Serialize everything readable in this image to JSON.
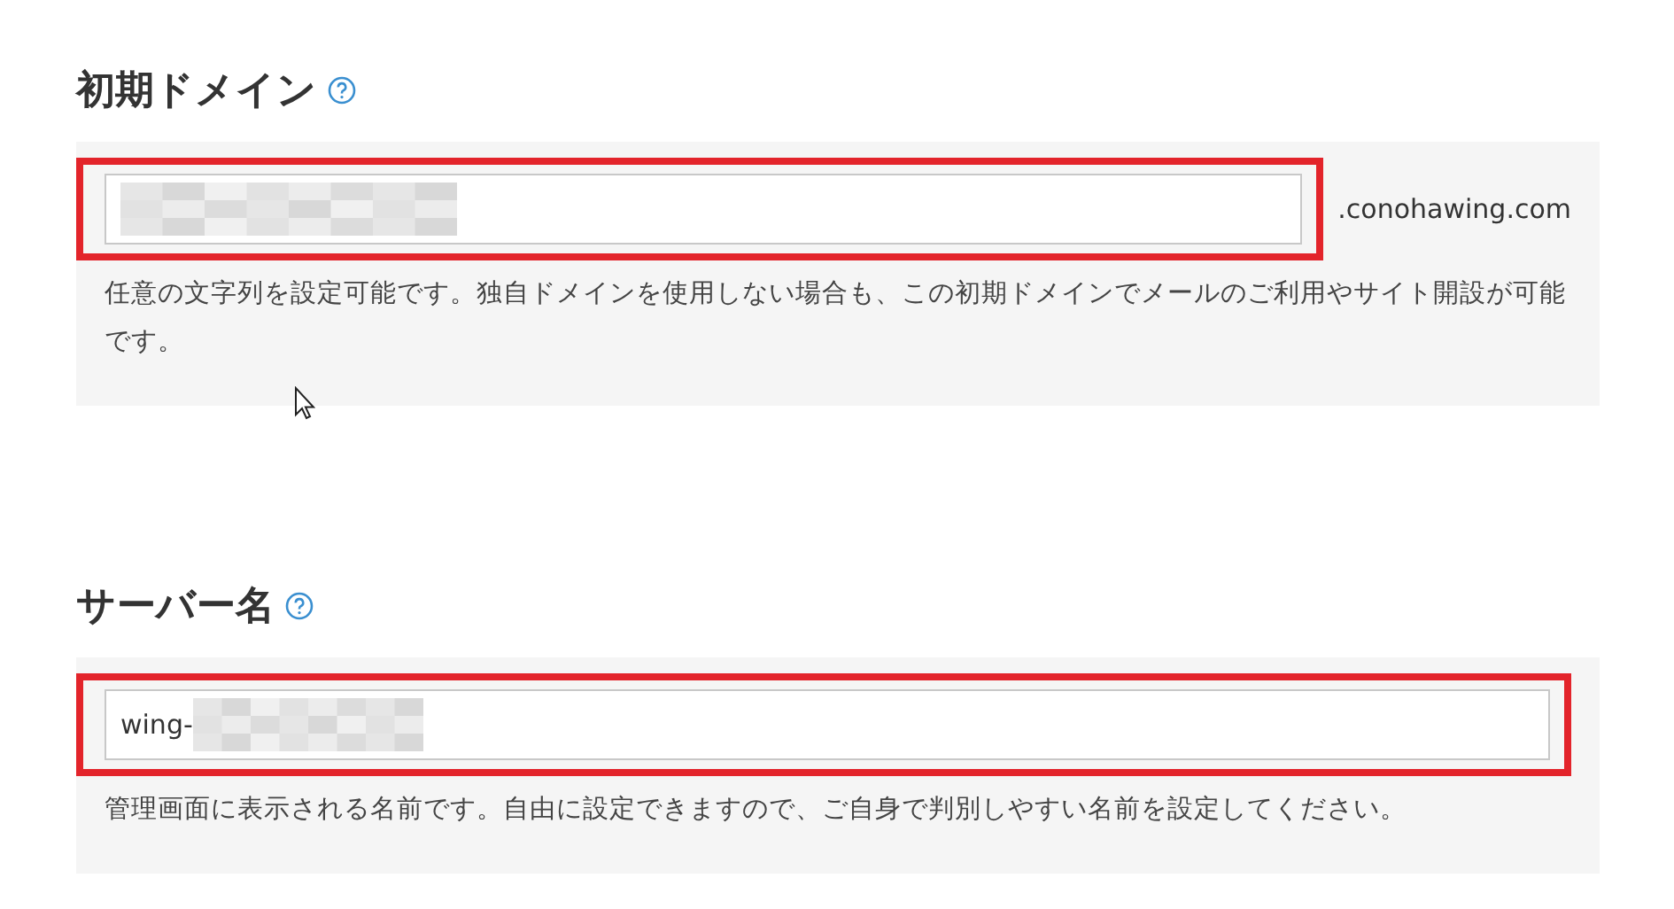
{
  "sections": [
    {
      "title": "初期ドメイン",
      "field": {
        "redacted": true,
        "suffix": ".conohawing.com",
        "highlighted": true
      },
      "help": "任意の文字列を設定可能です。独自ドメインを使用しない場合も、この初期ドメインでメールのご利用やサイト開設が可能です。"
    },
    {
      "title": "サーバー名",
      "field": {
        "value": "wing-",
        "redacted": true,
        "highlighted": true
      },
      "help": "管理画面に表示される名前です。自由に設定できますので、ご自身で判別しやすい名前を設定してください。"
    }
  ]
}
